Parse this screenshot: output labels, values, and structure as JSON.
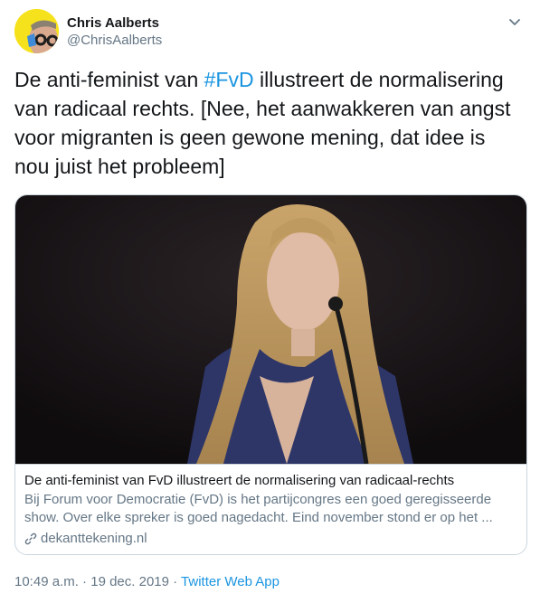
{
  "author": {
    "name": "Chris Aalberts",
    "handle": "@ChrisAalberts"
  },
  "tweet": {
    "text_before": "De anti-feminist van ",
    "hashtag": "#FvD",
    "text_after": " illustreert de normalisering van radicaal rechts. [Nee, het aanwakkeren van angst voor migranten is geen gewone mening, dat idee is nou juist het probleem]"
  },
  "card": {
    "title": "De anti-feminist van FvD illustreert de normalisering van radicaal-rechts",
    "description": "Bij Forum voor Democratie (FvD) is het partijcongres een goed geregisseerde show. Over elke spreker is goed nagedacht. Eind november stond er op het ...",
    "domain": "dekanttekening.nl"
  },
  "meta": {
    "time": "10:49 a.m.",
    "separator": " · ",
    "date": "19 dec. 2019",
    "source": "Twitter Web App"
  },
  "icons": {
    "caret": "chevron-down-icon",
    "link": "link-icon"
  },
  "colors": {
    "link_blue": "#1b95e0",
    "secondary_text": "#657786",
    "border": "#ccd6dd",
    "avatar_bg": "#f6e21c"
  }
}
